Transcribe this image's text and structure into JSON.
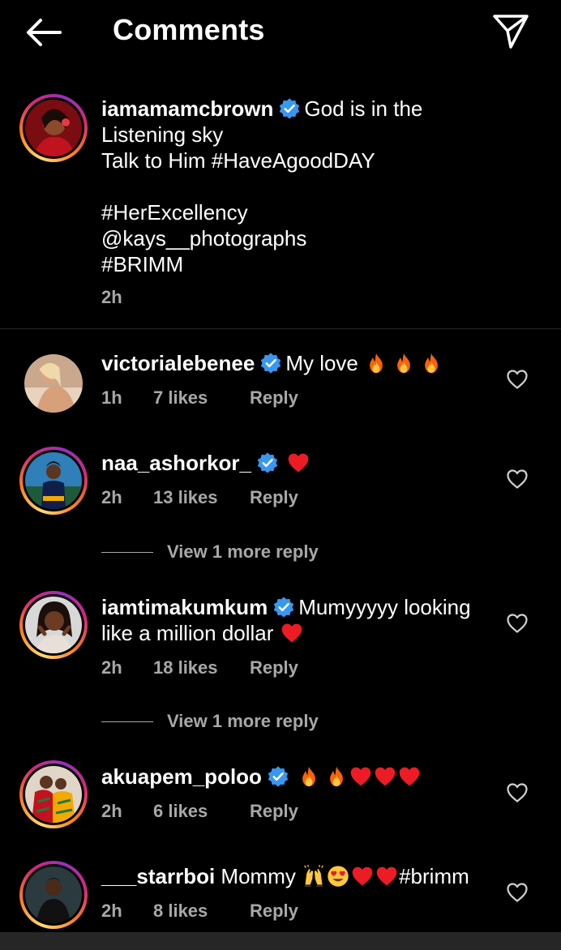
{
  "header": {
    "title": "Comments",
    "back_icon": "arrow-left-icon",
    "send_icon": "paper-plane-icon"
  },
  "colors": {
    "background": "#000000",
    "text": "#ffffff",
    "muted": "#a8a8a8",
    "verified": "#3897f0",
    "heart_red": "#ed1c24"
  },
  "caption": {
    "username": "iamamamcbrown",
    "verified": true,
    "lines": [
      "God is in the",
      "Listening sky",
      "Talk to Him #HaveAgoodDAY",
      "",
      "#HerExcellency",
      "@kays__photographs",
      "#BRIMM"
    ],
    "time": "2h"
  },
  "comments": [
    {
      "username": "victorialebenee",
      "verified": true,
      "text": "My love",
      "emojis": [
        "fire",
        "fire",
        "fire"
      ],
      "time": "1h",
      "likes": "7 likes",
      "reply": "Reply"
    },
    {
      "username": "naa_ashorkor_",
      "verified": true,
      "text": "",
      "emojis": [
        "red-heart"
      ],
      "time": "2h",
      "likes": "13 likes",
      "reply": "Reply",
      "more_replies": "View 1 more reply"
    },
    {
      "username": "iamtimakumkum",
      "verified": true,
      "text_line1": "Mumyyyyy looking",
      "text_line2": "like a million dollar",
      "emojis": [
        "red-heart"
      ],
      "time": "2h",
      "likes": "18 likes",
      "reply": "Reply",
      "more_replies": "View 1 more reply"
    },
    {
      "username": "akuapem_poloo",
      "verified": true,
      "text": "",
      "emojis": [
        "fire",
        "fire",
        "red-heart",
        "red-heart",
        "red-heart"
      ],
      "time": "2h",
      "likes": "6 likes",
      "reply": "Reply"
    },
    {
      "username": "___starrboi",
      "verified": false,
      "text": "Mommy",
      "text_after": "#brimm",
      "emojis": [
        "raising-hands",
        "heart-eyes",
        "red-heart",
        "red-heart"
      ],
      "time": "2h",
      "likes": "8 likes",
      "reply": "Reply"
    }
  ]
}
